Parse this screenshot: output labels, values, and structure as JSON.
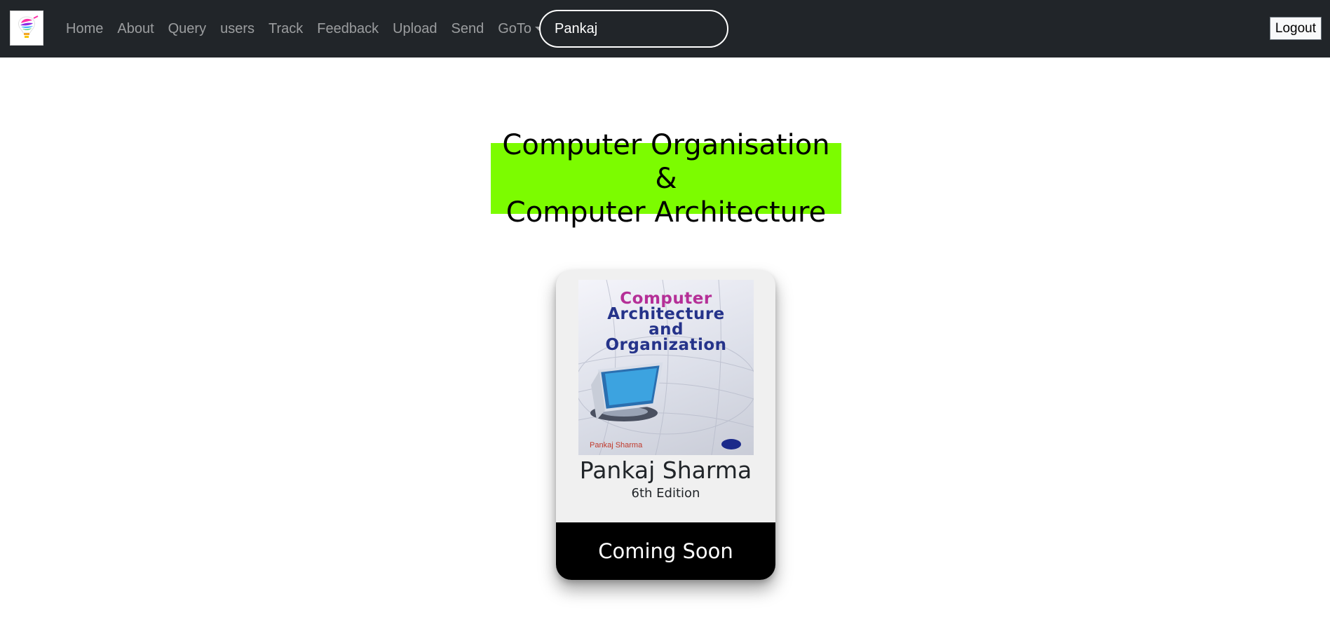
{
  "navbar": {
    "logo": {
      "icon": "lightbulb-logo-icon"
    },
    "links": [
      {
        "label": "Home"
      },
      {
        "label": "About"
      },
      {
        "label": "Query"
      },
      {
        "label": "users"
      },
      {
        "label": "Track"
      },
      {
        "label": "Feedback"
      },
      {
        "label": "Upload"
      },
      {
        "label": "Send"
      }
    ],
    "dropdown": {
      "label": "GoTo",
      "icon": "caret-down-icon"
    },
    "search": {
      "value": "Pankaj"
    },
    "logout_label": "Logout"
  },
  "page": {
    "title_line1": "Computer Organisation &",
    "title_line2": "Computer Architecture",
    "title_bg": "#7cfc00"
  },
  "book": {
    "cover": {
      "title_line1": "Computer",
      "title_line2": "Architecture",
      "title_line3": "and",
      "title_line4": "Organization",
      "author": "Pankaj Sharma"
    },
    "author": "Pankaj Sharma",
    "edition": "6th Edition",
    "status": "Coming Soon"
  }
}
